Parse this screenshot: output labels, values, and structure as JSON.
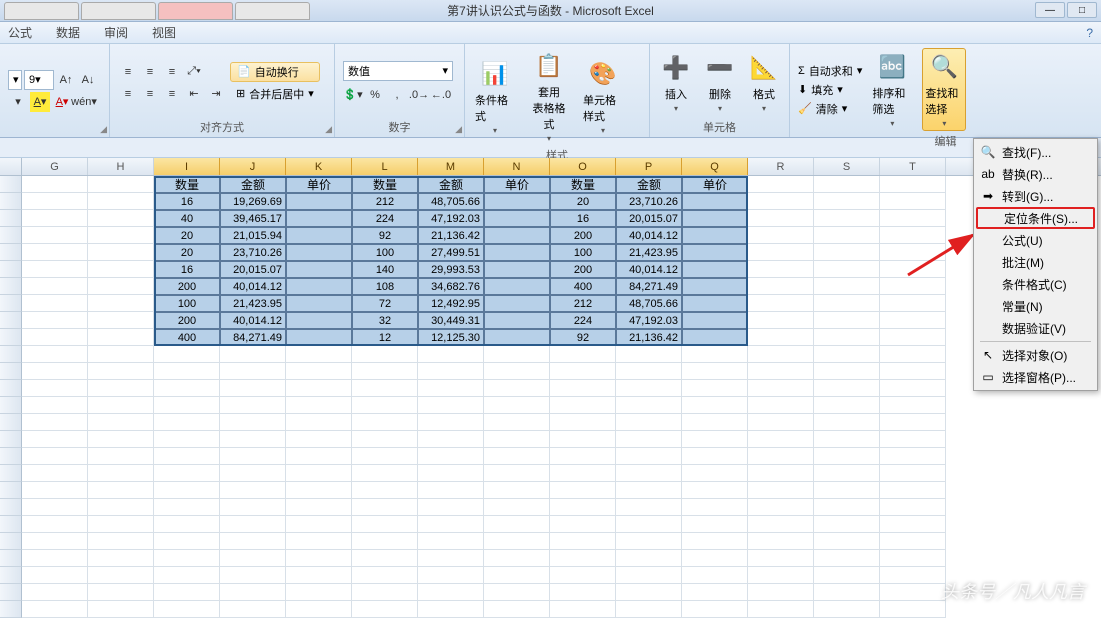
{
  "app": {
    "title": "第7讲认识公式与函数  -  Microsoft Excel"
  },
  "menu": {
    "items": [
      "公式",
      "数据",
      "审阅",
      "视图"
    ],
    "help": "?"
  },
  "ribbon": {
    "font": {
      "size": "9",
      "label": ""
    },
    "align": {
      "label": "对齐方式",
      "wrap": "自动换行",
      "merge": "合并后居中"
    },
    "number": {
      "label": "数字",
      "format": "数值"
    },
    "styles": {
      "label": "样式",
      "cond": "条件格式",
      "table": "套用\n表格格式",
      "cell": "单元格样式"
    },
    "cells": {
      "label": "单元格",
      "insert": "插入",
      "delete": "删除",
      "format": "格式"
    },
    "edit": {
      "label": "编辑",
      "sum": "自动求和",
      "fill": "填充",
      "clear": "清除",
      "sort": "排序和筛选",
      "find": "查找和选择"
    }
  },
  "columns": [
    "G",
    "H",
    "I",
    "J",
    "K",
    "L",
    "M",
    "N",
    "O",
    "P",
    "Q",
    "R",
    "S",
    "T"
  ],
  "sel_cols": [
    "I",
    "J",
    "K",
    "L",
    "M",
    "N",
    "O",
    "P",
    "Q"
  ],
  "headers": [
    "数量",
    "金额",
    "单价",
    "数量",
    "金额",
    "单价",
    "数量",
    "金额",
    "单价"
  ],
  "rows": [
    [
      "16",
      "19,269.69",
      "",
      "212",
      "48,705.66",
      "",
      "20",
      "23,710.26",
      ""
    ],
    [
      "40",
      "39,465.17",
      "",
      "224",
      "47,192.03",
      "",
      "16",
      "20,015.07",
      ""
    ],
    [
      "20",
      "21,015.94",
      "",
      "92",
      "21,136.42",
      "",
      "200",
      "40,014.12",
      ""
    ],
    [
      "20",
      "23,710.26",
      "",
      "100",
      "27,499.51",
      "",
      "100",
      "21,423.95",
      ""
    ],
    [
      "16",
      "20,015.07",
      "",
      "140",
      "29,993.53",
      "",
      "200",
      "40,014.12",
      ""
    ],
    [
      "200",
      "40,014.12",
      "",
      "108",
      "34,682.76",
      "",
      "400",
      "84,271.49",
      ""
    ],
    [
      "100",
      "21,423.95",
      "",
      "72",
      "12,492.95",
      "",
      "212",
      "48,705.66",
      ""
    ],
    [
      "200",
      "40,014.12",
      "",
      "32",
      "30,449.31",
      "",
      "224",
      "47,192.03",
      ""
    ],
    [
      "400",
      "84,271.49",
      "",
      "12",
      "12,125.30",
      "",
      "92",
      "21,136.42",
      ""
    ]
  ],
  "ctx": {
    "find": "查找(F)...",
    "replace": "替换(R)...",
    "goto": "转到(G)...",
    "special": "定位条件(S)...",
    "formulas": "公式(U)",
    "comments": "批注(M)",
    "condfmt": "条件格式(C)",
    "constants": "常量(N)",
    "validation": "数据验证(V)",
    "selobj": "选择对象(O)",
    "selpane": "选择窗格(P)..."
  },
  "watermark": "头条号／凡人凡言"
}
